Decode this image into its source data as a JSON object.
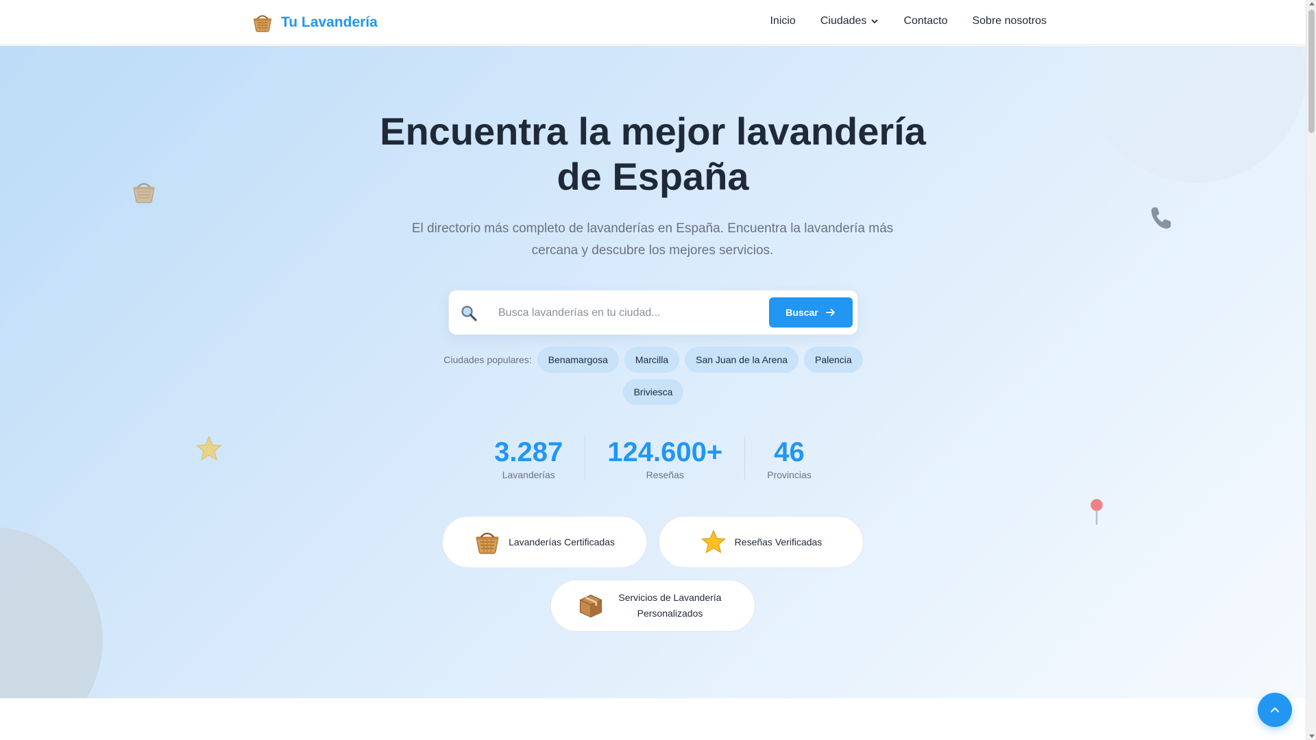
{
  "header": {
    "brand_name": "Tu Lavandería",
    "brand_icon": "basket-icon",
    "nav": {
      "home": "Inicio",
      "cities": "Ciudades",
      "contact": "Contacto",
      "about": "Sobre nosotros"
    }
  },
  "hero": {
    "headline_line1": "Encuentra la mejor lavandería",
    "headline_line2": "de España",
    "subtitle_line1": "El directorio más completo de lavanderías en España. Encuentra la lavandería más",
    "subtitle_line2": "cercana y descubre los mejores servicios.",
    "search": {
      "placeholder": "Busca lavanderías en tu ciudad...",
      "value": "",
      "button_label": "Buscar"
    },
    "popular": {
      "label": "Ciudades populares:",
      "cities": [
        "Benamargosa",
        "Marcilla",
        "San Juan de la Arena",
        "Palencia",
        "Briviesca"
      ]
    },
    "stats": [
      {
        "value": "3.287",
        "label": "Lavanderías"
      },
      {
        "value": "124.600+",
        "label": "Reseñas"
      },
      {
        "value": "46",
        "label": "Provincias"
      }
    ],
    "features": {
      "certified": "Lavanderías Certificadas",
      "verified_reviews": "Reseñas Verificadas",
      "custom_services_line1": "Servicios de Lavandería",
      "custom_services_line2": "Personalizados"
    }
  },
  "colors": {
    "accent": "#2196f3",
    "chip": "#c7e2f9",
    "text": "#1f2937",
    "muted": "#6b7280"
  }
}
